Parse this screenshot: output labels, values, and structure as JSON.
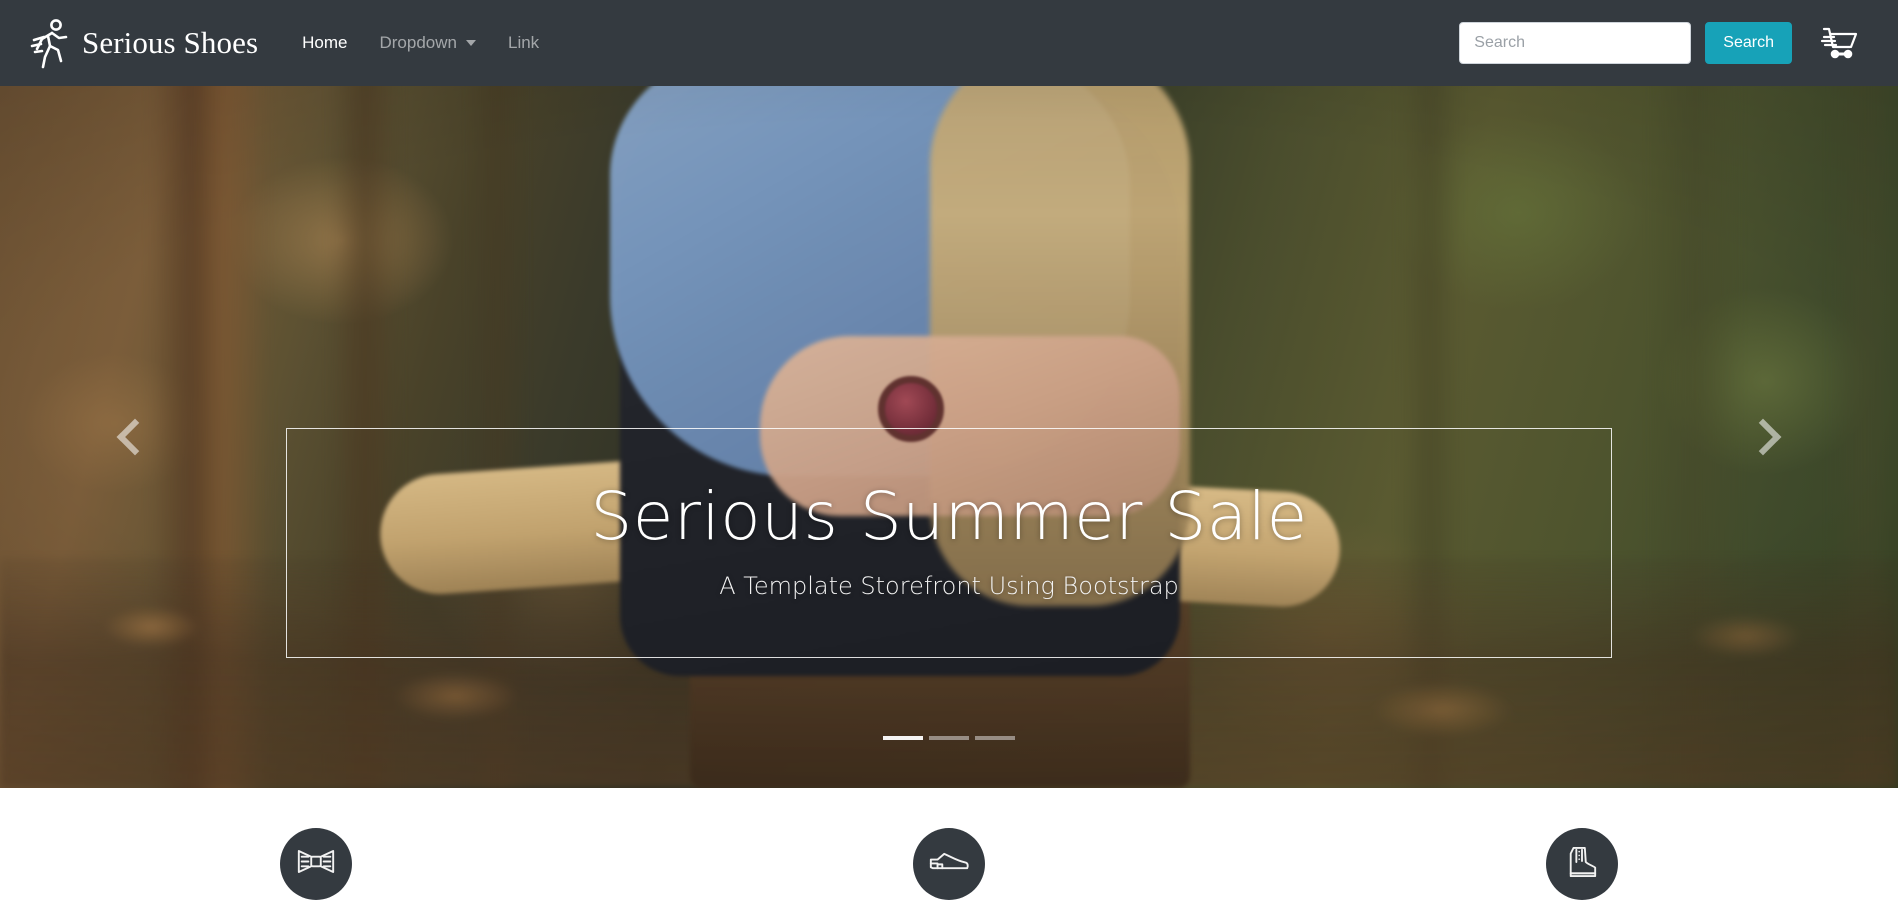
{
  "site": {
    "brand_name": "Serious Shoes",
    "brand_icon": "running-person-icon",
    "accent_color": "#17a2b8",
    "navbar_color": "#343a40"
  },
  "navbar": {
    "links": [
      {
        "label": "Home",
        "active": true,
        "has_caret": false
      },
      {
        "label": "Dropdown",
        "active": false,
        "has_caret": true
      },
      {
        "label": "Link",
        "active": false,
        "has_caret": false
      }
    ],
    "search": {
      "placeholder": "Search",
      "value": "",
      "button_label": "Search"
    },
    "cart_icon": "shopping-cart-icon"
  },
  "carousel": {
    "title": "Serious Summer Sale",
    "subtitle": "A Template Storefront Using Bootstrap",
    "prev_icon": "chevron-left-icon",
    "next_icon": "chevron-right-icon",
    "prev_label": "Previous",
    "next_label": "Next",
    "slide_count": 3,
    "active_slide": 1,
    "indicators": [
      "1",
      "2",
      "3"
    ]
  },
  "features": [
    {
      "icon": "bow-tie-icon"
    },
    {
      "icon": "dress-shoe-icon"
    },
    {
      "icon": "boot-icon"
    }
  ]
}
